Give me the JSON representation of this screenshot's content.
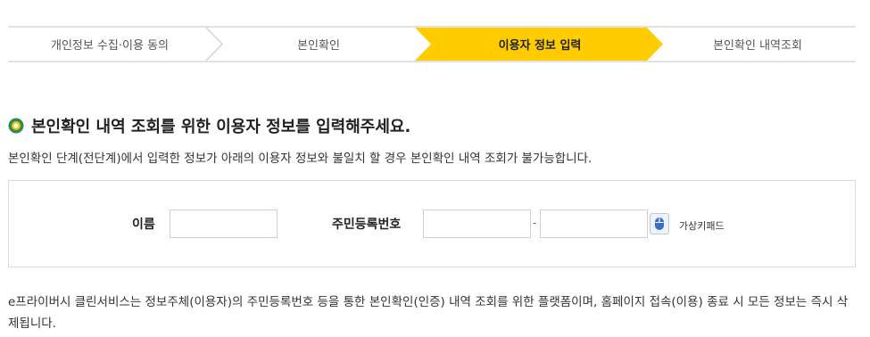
{
  "steps": [
    {
      "label": "개인정보 수집·이용 동의"
    },
    {
      "label": "본인확인"
    },
    {
      "label": "이용자 정보 입력"
    },
    {
      "label": "본인확인 내역조회"
    }
  ],
  "heading": "본인확인 내역 조회를 위한 이용자 정보를 입력해주세요.",
  "description": "본인확인 단계(전단계)에서 입력한 정보가 아래의 이용자 정보와 불일치 할 경우 본인확인 내역 조회가 불가능합니다.",
  "form": {
    "name_label": "이름",
    "name_value": "",
    "jumin_label": "주민등록번호",
    "jumin_first": "",
    "jumin_second": "",
    "separator": "-",
    "virtual_keypad_label": "가상키패드"
  },
  "notice": "e프라이버시 클린서비스는 정보주체(이용자)의 주민등록번호 등을 통한 본인확인(인증) 내역 조회를 위한 플랫폼이며, 홈페이지 접속(이용) 종료 시 모든 정보는 즉시 삭제됩니다.",
  "colors": {
    "active_step": "#ffcc00",
    "bullet_outer": "#2e8b57",
    "border": "#d9d9d9"
  }
}
